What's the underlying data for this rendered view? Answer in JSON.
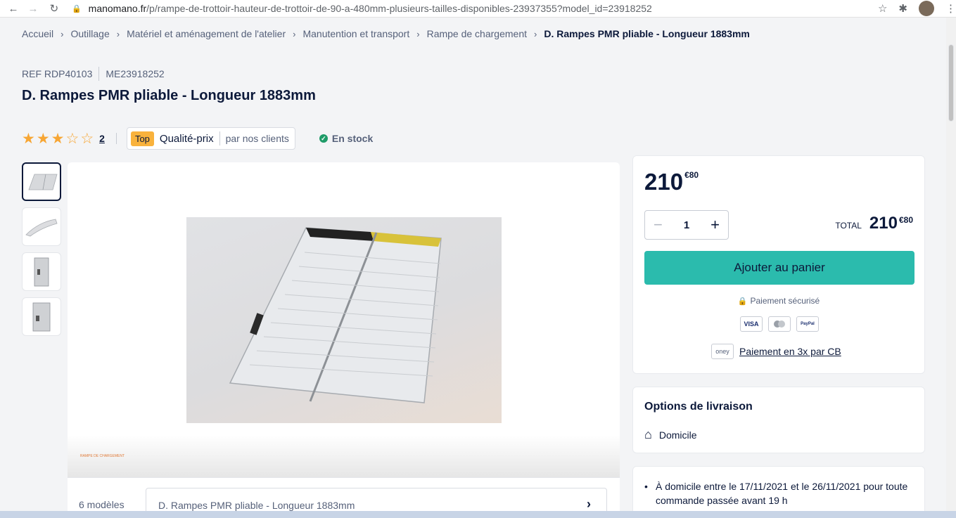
{
  "browser": {
    "url_host": "manomano.fr",
    "url_path": "/p/rampe-de-trottoir-hauteur-de-trottoir-de-90-a-480mm-plusieurs-tailles-disponibles-23937355?model_id=23918252"
  },
  "breadcrumb": [
    "Accueil",
    "Outillage",
    "Matériel et aménagement de l'atelier",
    "Manutention et transport",
    "Rampe de chargement",
    "D. Rampes PMR pliable - Longueur 1883mm"
  ],
  "product": {
    "ref": "REF RDP40103",
    "me": "ME23918252",
    "title": "D. Rampes PMR pliable - Longueur 1883mm",
    "rating": 3,
    "rating_max": 5,
    "review_count": "2",
    "badge_top": "Top",
    "badge_quality": "Qualité-prix",
    "badge_by": "par nos clients",
    "stock": "En stock",
    "models_label": "6 modèles",
    "selected_model": "D. Rampes PMR pliable - Longueur 1883mm"
  },
  "purchase": {
    "price_int": "210",
    "price_cents": "€80",
    "quantity": "1",
    "total_label": "TOTAL",
    "total_int": "210",
    "total_cents": "€80",
    "add_to_cart": "Ajouter au panier",
    "secure_payment": "Paiement sécurisé",
    "payment_methods": [
      "VISA",
      "MC",
      "PayPal"
    ],
    "oney_logo": "oney",
    "oney_text": "Paiement en 3x par CB"
  },
  "delivery": {
    "heading": "Options de livraison",
    "option": "Domicile",
    "info": "À domicile entre le 17/11/2021 et le 26/11/2021 pour toute commande passée avant 19 h"
  },
  "colors": {
    "primary": "#2bbbad",
    "star": "#f7a634",
    "badge": "#f9b23c",
    "stock": "#1f9b68",
    "text": "#0c193a"
  }
}
